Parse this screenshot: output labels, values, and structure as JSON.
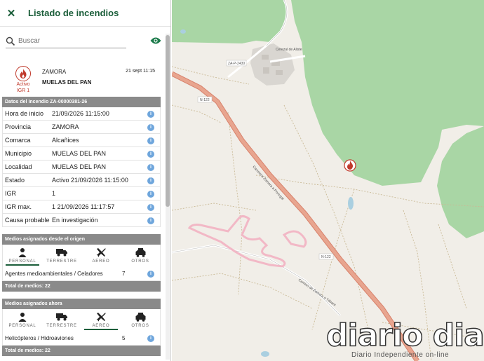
{
  "panel": {
    "title": "Listado de incendios",
    "search_placeholder": "Buscar"
  },
  "fire": {
    "status": "Activo",
    "igr": "IGR 1",
    "province": "ZAMORA",
    "date": "21 sept 11:15",
    "locality": "MUELAS DEL PAN"
  },
  "details": {
    "header": "Datos del incendio ZA-00000381-26",
    "rows": [
      {
        "label": "Hora de inicio",
        "value": "21/09/2026 11:15:00"
      },
      {
        "label": "Provincia",
        "value": "ZAMORA"
      },
      {
        "label": "Comarca",
        "value": "Alcañices"
      },
      {
        "label": "Municipio",
        "value": "MUELAS DEL PAN"
      },
      {
        "label": "Localidad",
        "value": "MUELAS DEL PAN"
      },
      {
        "label": "Estado",
        "value": "Activo 21/09/2026 11:15:00"
      },
      {
        "label": "IGR",
        "value": "1"
      },
      {
        "label": "IGR max.",
        "value": "1 21/09/2026 11:17:57"
      },
      {
        "label": "Causa probable",
        "value": "En investigación"
      }
    ]
  },
  "origin": {
    "header": "Medios asignados desde el origen",
    "tabs": [
      "PERSONAL",
      "TERRESTRE",
      "AEREO",
      "OTROS"
    ],
    "active_tab": "PERSONAL",
    "row": {
      "label": "Agentes medioambientales / Celadores",
      "count": "7"
    },
    "total": "Total de medios: 22"
  },
  "current": {
    "header": "Medios asignados ahora",
    "tabs": [
      "PERSONAL",
      "TERRESTRE",
      "AEREO",
      "OTROS"
    ],
    "active_tab": "AEREO",
    "row": {
      "label": "Helicópteros / Hidroaviones",
      "count": "5"
    },
    "total": "Total de medios: 22"
  },
  "map": {
    "labels": {
      "road_n122_a": "N-122",
      "road_n122_b": "N-122",
      "road_za": "ZA-P-2430",
      "village": "Cerezal de Aliste",
      "street": "Carretera Zamora a Portugal",
      "street2": "Camino de Zamora a Tábara"
    }
  },
  "watermark": {
    "brand": "diario dia",
    "tagline": "Diario Independiente on-line"
  },
  "colors": {
    "brand_green": "#1b5e3a",
    "fire_red": "#c0392b",
    "forest": "#a9d6a5",
    "land": "#f1eee8",
    "road": "#e8a58f"
  }
}
